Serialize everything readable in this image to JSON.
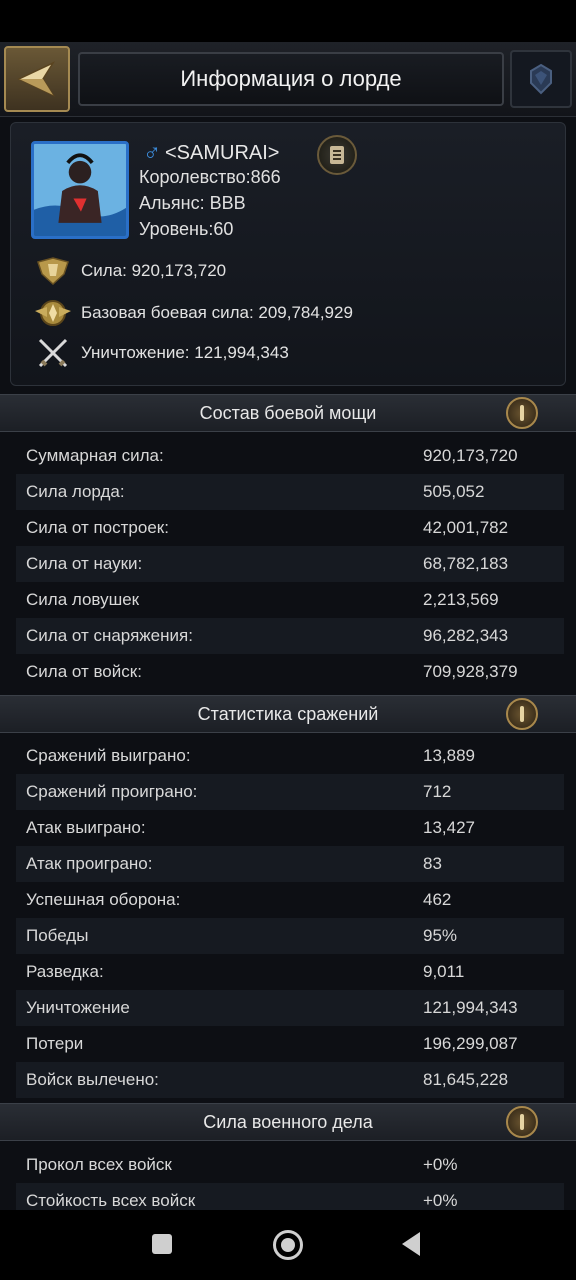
{
  "header": {
    "title": "Информация о лорде"
  },
  "profile": {
    "gender_symbol": "♂",
    "name": "<SAMURAI>",
    "kingdom": "Королевство:866",
    "alliance": "Альянс: BBB",
    "level": "Уровень:60",
    "power": "Сила: 920,173,720",
    "base_power": "Базовая боевая сила: 209,784,929",
    "kills": "Уничтожение: 121,994,343"
  },
  "sections": [
    {
      "title": "Состав боевой мощи",
      "rows": [
        {
          "label": "Суммарная сила:",
          "value": "920,173,720"
        },
        {
          "label": "Сила лорда:",
          "value": "505,052"
        },
        {
          "label": "Сила от построек:",
          "value": "42,001,782"
        },
        {
          "label": "Сила от науки:",
          "value": "68,782,183"
        },
        {
          "label": "Сила ловушек",
          "value": "2,213,569"
        },
        {
          "label": "Сила от снаряжения:",
          "value": "96,282,343"
        },
        {
          "label": "Сила от войск:",
          "value": "709,928,379"
        }
      ]
    },
    {
      "title": "Статистика сражений",
      "rows": [
        {
          "label": "Сражений выиграно:",
          "value": "13,889"
        },
        {
          "label": "Сражений проиграно:",
          "value": "712"
        },
        {
          "label": "Атак выиграно:",
          "value": "13,427"
        },
        {
          "label": "Атак проиграно:",
          "value": "83"
        },
        {
          "label": "Успешная оборона:",
          "value": "462"
        },
        {
          "label": "Победы",
          "value": "95%"
        },
        {
          "label": "Разведка:",
          "value": "9,011"
        },
        {
          "label": "Уничтожение",
          "value": "121,994,343"
        },
        {
          "label": "Потери",
          "value": "196,299,087"
        },
        {
          "label": "Войск вылечено:",
          "value": "81,645,228"
        }
      ]
    },
    {
      "title": "Сила военного дела",
      "rows": [
        {
          "label": "Прокол всех войск",
          "value": "+0%"
        },
        {
          "label": "Стойкость всех войск",
          "value": "+0%"
        }
      ]
    }
  ],
  "colors": {
    "accent_gold": "#a8884c",
    "male_blue": "#3d8fe0",
    "avatar_frame": "#2a6fc7"
  },
  "icons": [
    "back-arrow-icon",
    "alliance-crest-icon",
    "male-icon",
    "document-icon",
    "power-emblem-icon",
    "base-power-emblem-icon",
    "crossed-swords-icon",
    "toggle-icon"
  ]
}
